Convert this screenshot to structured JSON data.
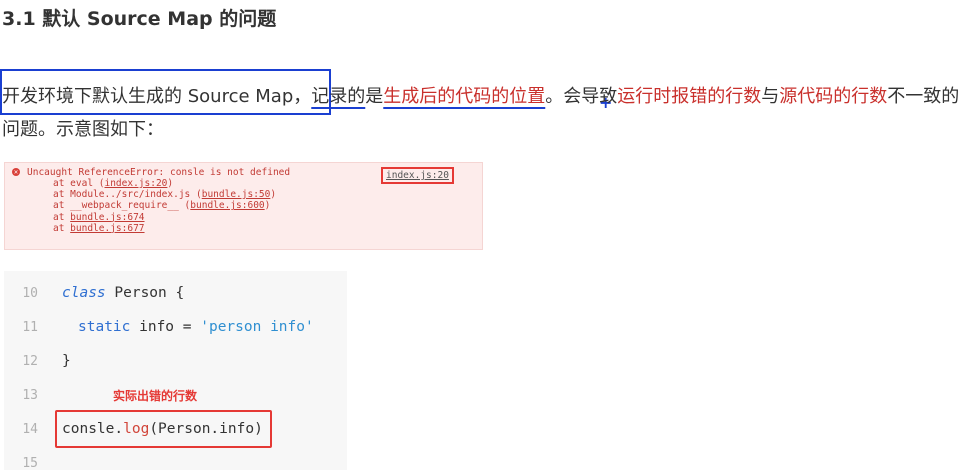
{
  "heading": "3.1 默认 Source Map 的问题",
  "paragraph": {
    "p1": "开发环境下默认生成的 Source Map，",
    "p2": "记录的",
    "p3": "是",
    "p4": "生成后的代码的位置",
    "p5": "。会导致",
    "p6": "运行时报错的行数",
    "p7": "与",
    "p8": "源代码的行数",
    "p9": "不一致的问题。示意图如下："
  },
  "error_panel": {
    "icon": "error-icon",
    "message": "Uncaught ReferenceError: consle is not defined",
    "source_link": "index.js:20",
    "stack": [
      {
        "prefix": "at eval (",
        "link": "index.js:20",
        "suffix": ")"
      },
      {
        "prefix": "at Module../src/index.js (",
        "link": "bundle.js:50",
        "suffix": ")"
      },
      {
        "prefix": "at __webpack_require__ (",
        "link": "bundle.js:600",
        "suffix": ")"
      },
      {
        "prefix": "at ",
        "link": "bundle.js:674",
        "suffix": ""
      },
      {
        "prefix": "at ",
        "link": "bundle.js:677",
        "suffix": ""
      }
    ]
  },
  "code": {
    "lines": [
      {
        "num": "10",
        "keyword": "class",
        "text": " Person {"
      },
      {
        "num": "11",
        "kw": "static",
        "middle": " info = ",
        "str": "'person info'"
      },
      {
        "num": "12",
        "text": "}"
      },
      {
        "num": "13",
        "text": ""
      },
      {
        "num": "14",
        "obj": "consle.",
        "fn": "log",
        "args": "(Person.info)"
      },
      {
        "num": "15",
        "text": ""
      }
    ],
    "annotation": "实际出错的行数"
  },
  "colors": {
    "accent_red": "#c9302c",
    "annotation_blue": "#1a3fd1",
    "box_red": "#e53935"
  }
}
